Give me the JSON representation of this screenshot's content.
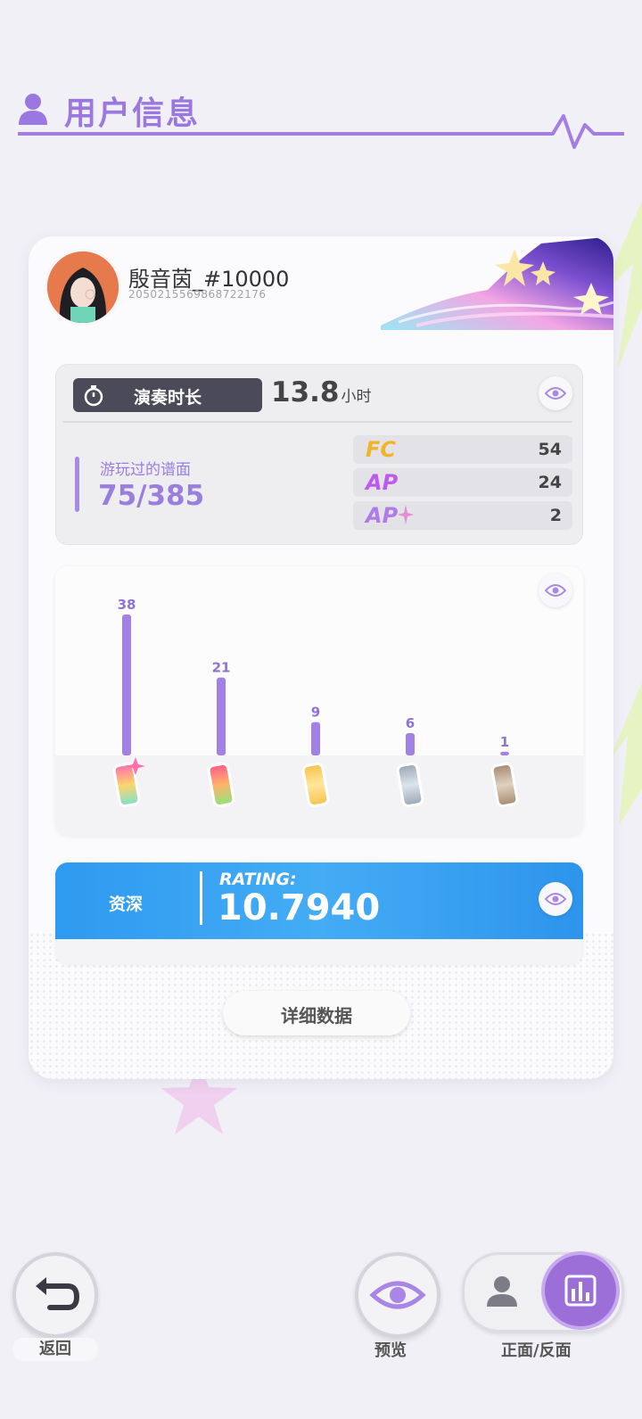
{
  "header": {
    "title": "用户信息",
    "accent": "#9b78e0"
  },
  "user": {
    "name": "殷音茵_#10000",
    "id": "2050215569868722176"
  },
  "play_time": {
    "label": "演奏时长",
    "value": "13.8",
    "unit": "小时"
  },
  "charts_played": {
    "label": "游玩过的谱面",
    "value": "75/385"
  },
  "badges": [
    {
      "name": "FC",
      "count": "54",
      "color": "#f0b428"
    },
    {
      "name": "AP",
      "count": "24",
      "color": "#c058ec"
    },
    {
      "name": "AP",
      "count": "2",
      "color": "#b07ae8",
      "icon": "sparkle-icon"
    }
  ],
  "chart_data": {
    "type": "bar",
    "categories": [
      "rainbow-icon",
      "pink-icon",
      "gold-icon",
      "silver-icon",
      "bronze-icon"
    ],
    "values": [
      38,
      21,
      9,
      6,
      1
    ],
    "bar_color": "#a181e6"
  },
  "rating": {
    "rank": "资深",
    "label": "RATING:",
    "value": "10.7940"
  },
  "details_button": "详细数据",
  "bottom": {
    "back": "返回",
    "preview": "预览",
    "toggle": "正面/反面"
  }
}
